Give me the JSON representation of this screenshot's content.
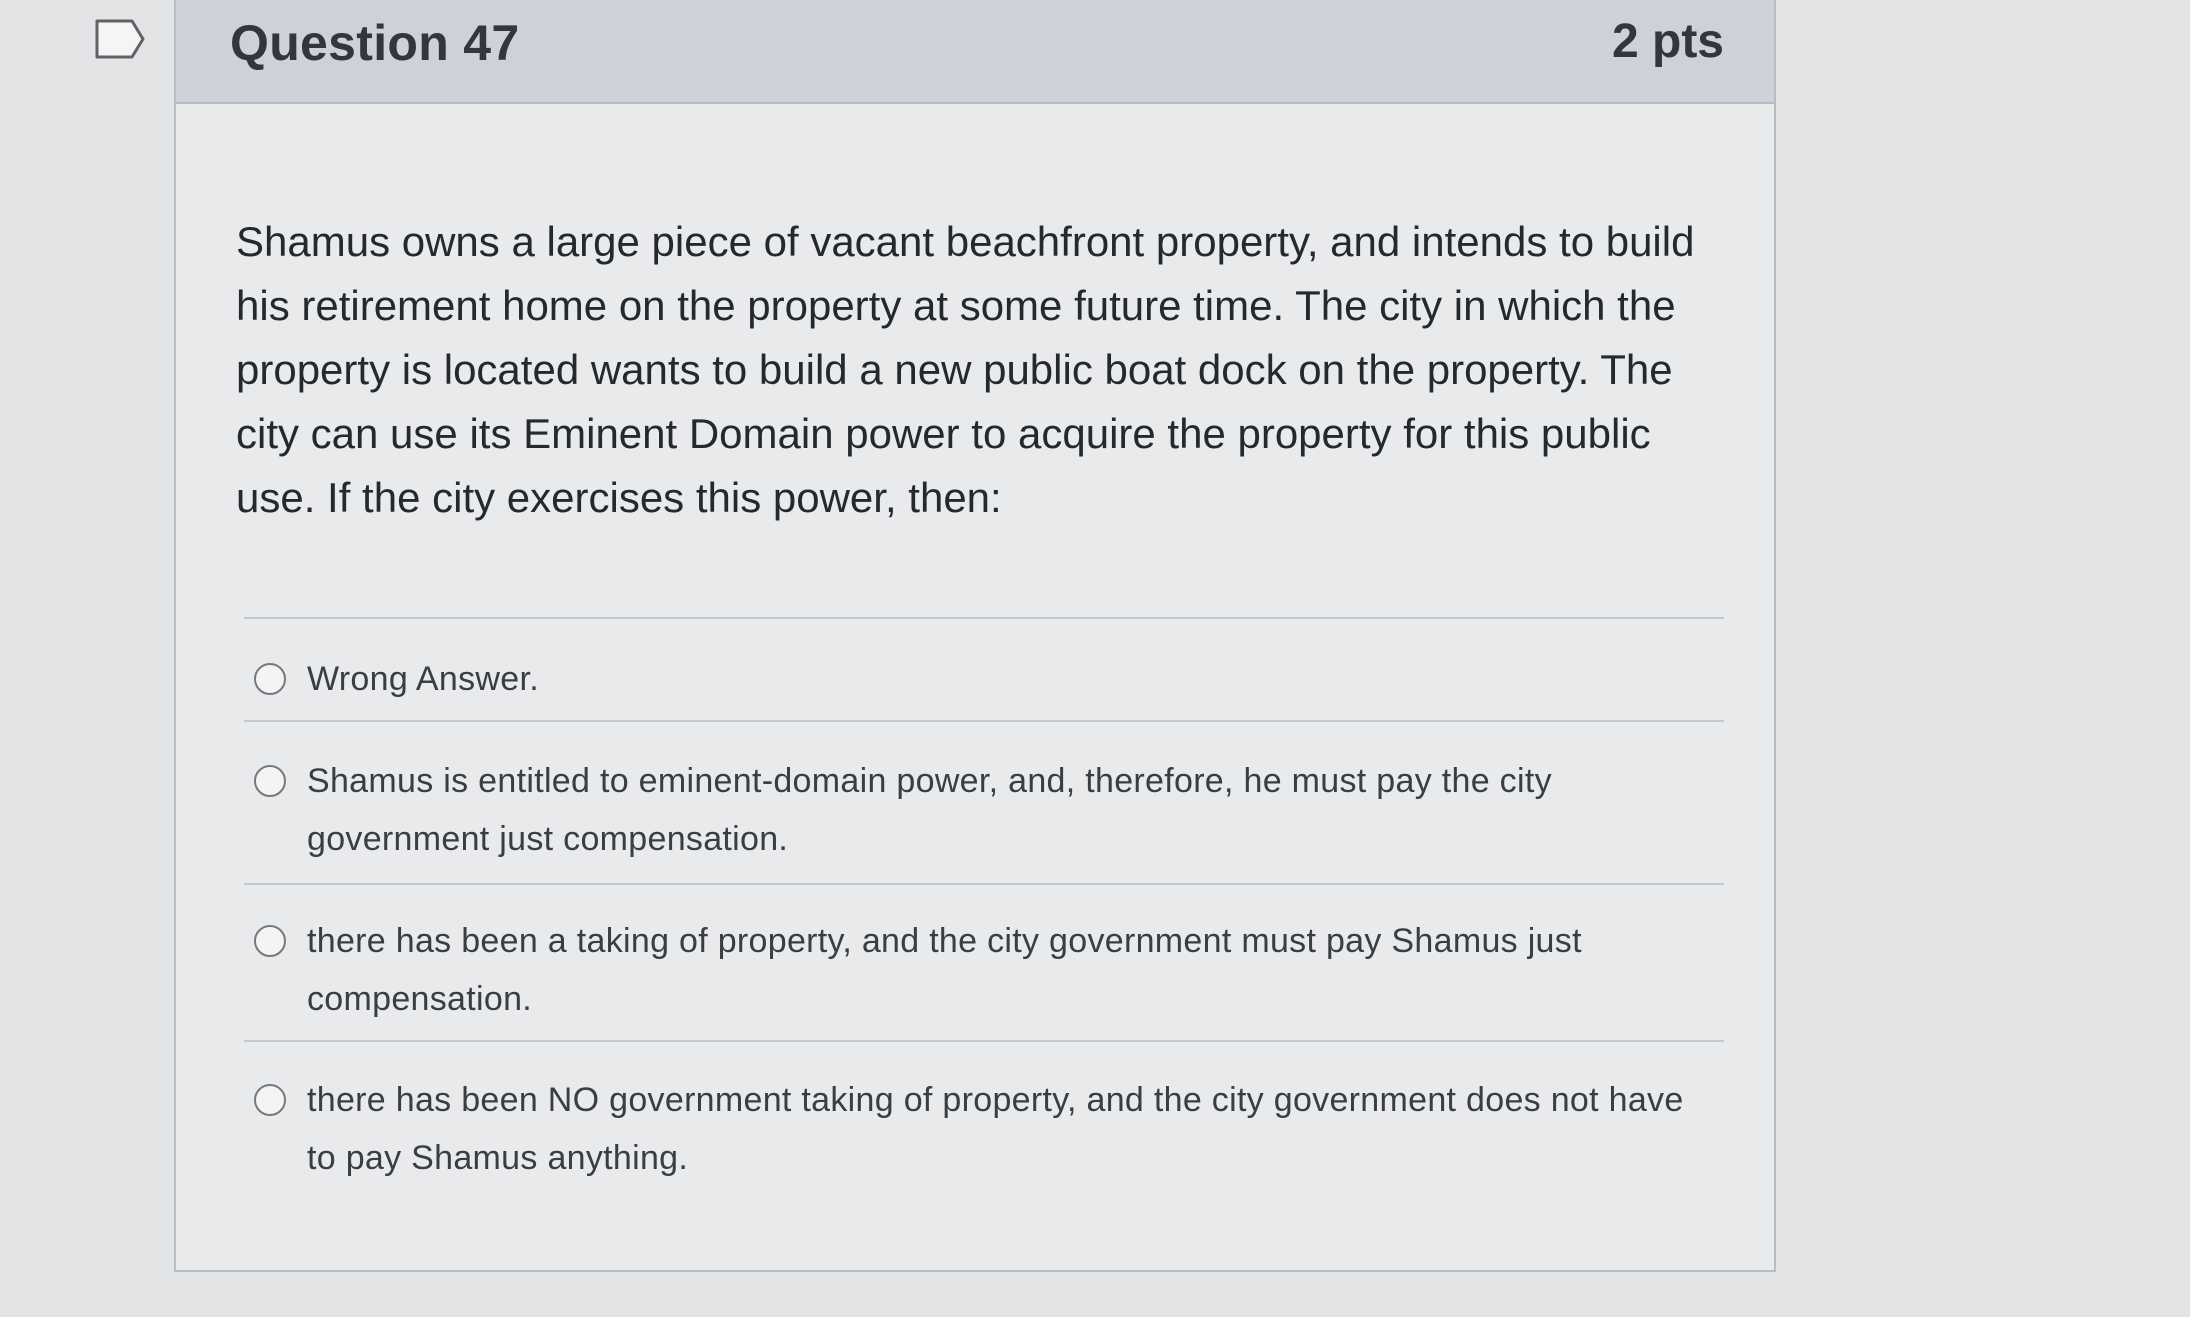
{
  "question": {
    "title": "Question 47",
    "points": "2 pts",
    "text": "Shamus owns a large piece of vacant beachfront property, and intends to build his retirement home on the property at some future time.  The city in which the property is located wants to build a new public boat dock on the property.  The city can use its Eminent Domain power to acquire the property for this public use.  If the city exercises this power, then:"
  },
  "answers": [
    {
      "label": "Wrong Answer."
    },
    {
      "label": "Shamus is entitled to eminent-domain power, and, therefore, he must pay the city government just compensation."
    },
    {
      "label": "there has been a taking of property, and the city government must pay Shamus just compensation."
    },
    {
      "label": "there has been NO government taking of property, and the city government does not have to pay Shamus anything."
    }
  ],
  "icons": {
    "bookmark": "bookmark-icon",
    "radio": "radio-button-icon"
  },
  "colors": {
    "header_background": "#cdd2d8",
    "card_background": "#e9eaeb",
    "page_background": "#e3e4e5",
    "text": "#25282c",
    "border": "#b9bcc0"
  }
}
